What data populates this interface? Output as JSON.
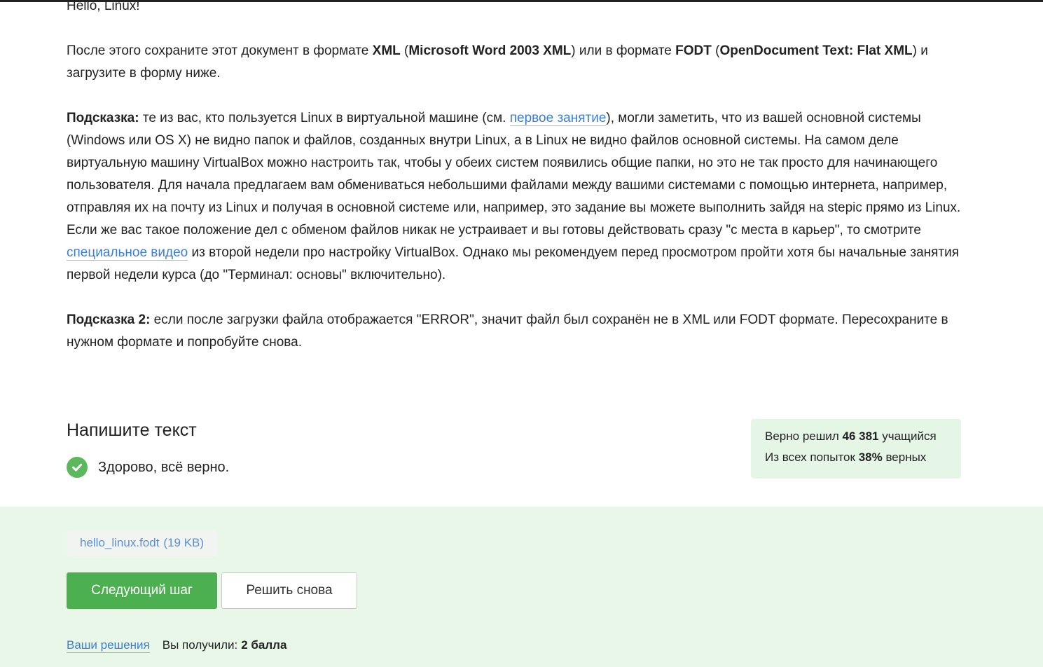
{
  "step": {
    "intro_line": "Hello, Linux!",
    "save_instruction": {
      "t1": "После этого сохраните этот документ в формате ",
      "b1": "XML",
      "t2": " (",
      "b2": "Microsoft Word 2003 XML",
      "t3": ") или в формате ",
      "b3": "FODT",
      "t4": " (",
      "b4": "OpenDocument Text: Flat XML",
      "t5": ") и загрузите в форму ниже."
    },
    "hint1": {
      "label": "Подсказка:",
      "t1": " те из вас, кто пользуется Linux в виртуальной машине (см. ",
      "link": "первое занятие",
      "t2": "), могли заметить, что из вашей основной системы (Windows или OS X) не видно папок и файлов, созданных внутри Linux, а в Linux не видно файлов основной системы. На самом деле виртуальную машину VirtualBox можно настроить так, чтобы у обеих систем появились общие папки, но это не так просто для начинающего пользователя. Для начала предлагаем вам обмениваться небольшими файлами между вашими системами с помощью интернета, например, отправляя их на почту из Linux и получая в основной системе или, например, это задание вы можете выполнить зайдя на stepic прямо из Linux."
    },
    "hint1_followup": {
      "t1": "Если же вас такое положение дел с обменом файлов никак не устраивает и вы готовы действовать сразу \"с места в карьер\", то смотрите ",
      "link": "специальное видео",
      "t2": " из второй недели про настройку VirtualBox. Однако мы рекомендуем перед просмотром пройти хотя бы начальные занятия первой недели курса (до \"Терминал: основы\" включительно)."
    },
    "hint2": {
      "label": "Подсказка 2:",
      "t1": " если после загрузки файла отображается \"ERROR\", значит файл был сохранён не в XML или FODT формате. Пересохраните в нужном формате и попробуйте снова."
    }
  },
  "task": {
    "title": "Напишите текст",
    "result_text": "Здорово, всё верно.",
    "result_icon": "check-circle-icon",
    "success_color": "#5cb85c"
  },
  "stats": {
    "solved_prefix": "Верно решил ",
    "solved_count": "46 381",
    "solved_suffix": " учащийся",
    "attempts_prefix": "Из всех попыток ",
    "attempts_percent": "38%",
    "attempts_suffix": " верных"
  },
  "submission": {
    "file_name": "hello_linux.fodt",
    "file_size": "(19 KB)",
    "next_button": "Следующий шаг",
    "retry_button": "Решить снова",
    "solutions_link": "Ваши решения",
    "score_prefix": "Вы получили:",
    "score_value": "2 балла",
    "accent_color": "#4caf50",
    "footer_bg": "#e8f7e8"
  }
}
